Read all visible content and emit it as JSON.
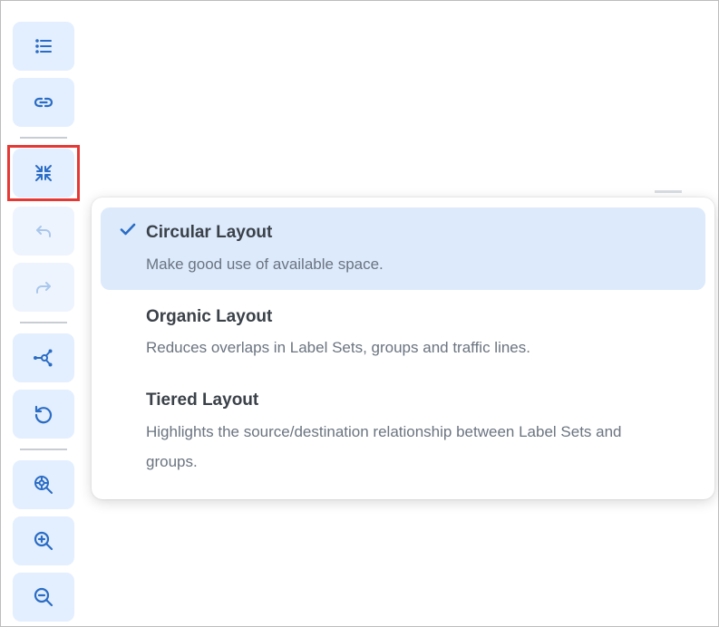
{
  "toolbar": {
    "buttons": [
      {
        "icon": "list-icon",
        "state": "enabled"
      },
      {
        "icon": "link-icon",
        "state": "enabled"
      },
      {
        "icon": "collapse-arrows-icon",
        "state": "active"
      },
      {
        "icon": "undo-icon",
        "state": "disabled"
      },
      {
        "icon": "redo-icon",
        "state": "disabled"
      },
      {
        "icon": "graph-layout-icon",
        "state": "enabled"
      },
      {
        "icon": "reset-icon",
        "state": "enabled"
      },
      {
        "icon": "zoom-fit-icon",
        "state": "enabled"
      },
      {
        "icon": "zoom-in-icon",
        "state": "enabled"
      },
      {
        "icon": "zoom-out-icon",
        "state": "enabled"
      }
    ],
    "accent_color": "#2b6cc4",
    "button_bg_color": "#e3efff"
  },
  "layout_menu": {
    "options": [
      {
        "title": "Circular Layout",
        "description": "Make good use of available space.",
        "selected": true
      },
      {
        "title": "Organic Layout",
        "description": "Reduces overlaps in Label Sets, groups and traffic lines.",
        "selected": false
      },
      {
        "title": "Tiered Layout",
        "description": "Highlights the source/destination relationship between Label Sets and groups.",
        "selected": false
      }
    ],
    "check_icon": "checkmark-icon",
    "selected_bg_color": "#dceafc"
  },
  "highlight_color": "#e53935"
}
